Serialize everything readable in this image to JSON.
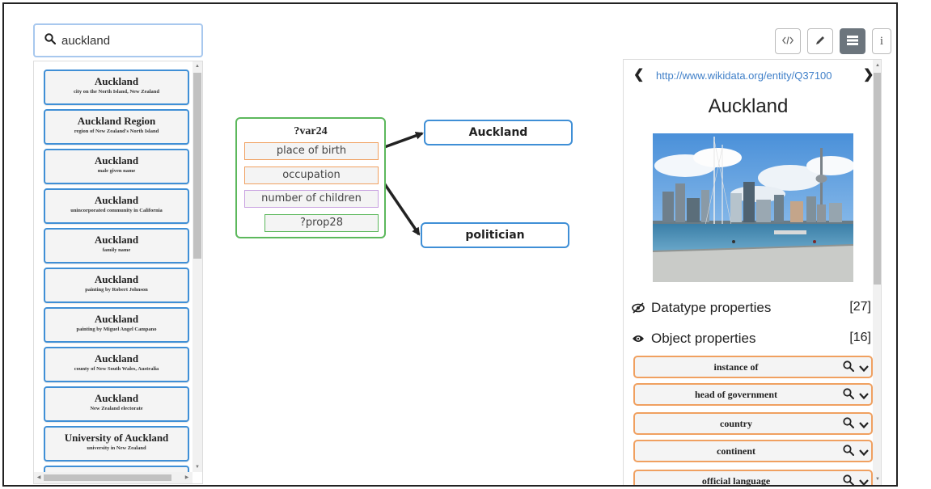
{
  "search": {
    "value": "auckland",
    "icon": "search-icon"
  },
  "results": [
    {
      "title": "Auckland",
      "description": "city on the North Island, New Zealand"
    },
    {
      "title": "Auckland Region",
      "description": "region of New Zealand's North Island"
    },
    {
      "title": "Auckland",
      "description": "male given name"
    },
    {
      "title": "Auckland",
      "description": "unincorporated community in California"
    },
    {
      "title": "Auckland",
      "description": "family name"
    },
    {
      "title": "Auckland",
      "description": "painting by Robert Johnson"
    },
    {
      "title": "Auckland",
      "description": "painting by Miguel Angel Campano"
    },
    {
      "title": "Auckland",
      "description": "county of New South Wales, Australia"
    },
    {
      "title": "Auckland",
      "description": "New Zealand electorate"
    },
    {
      "title": "University of Auckland",
      "description": "university in New Zealand"
    }
  ],
  "graph": {
    "variable_node": {
      "label": "?var24",
      "properties": [
        "place of birth",
        "occupation",
        "number of children"
      ],
      "sub_property": "?prop28"
    },
    "target_nodes": [
      "Auckland",
      "politician"
    ]
  },
  "toolbar": {
    "code_icon": "code-icon",
    "edit_icon": "pencil-icon",
    "list_icon": "list-icon",
    "info_label": "i"
  },
  "entity": {
    "uri": "http://www.wikidata.org/entity/Q37100",
    "title": "Auckland",
    "image_alt": "Auckland skyline with Sky Tower and harbour",
    "datatype_properties": {
      "label": "Datatype properties",
      "count": "[27]"
    },
    "object_properties": {
      "label": "Object properties",
      "count": "[16]"
    },
    "object_property_items": [
      "instance of",
      "head of government",
      "country",
      "continent",
      "official language"
    ]
  },
  "colors": {
    "accent_blue": "#3f8fd6",
    "variable_green": "#5cb85c",
    "property_orange": "#f0a060",
    "property_purple": "#c8a0e0",
    "active_button": "#6c757d"
  }
}
